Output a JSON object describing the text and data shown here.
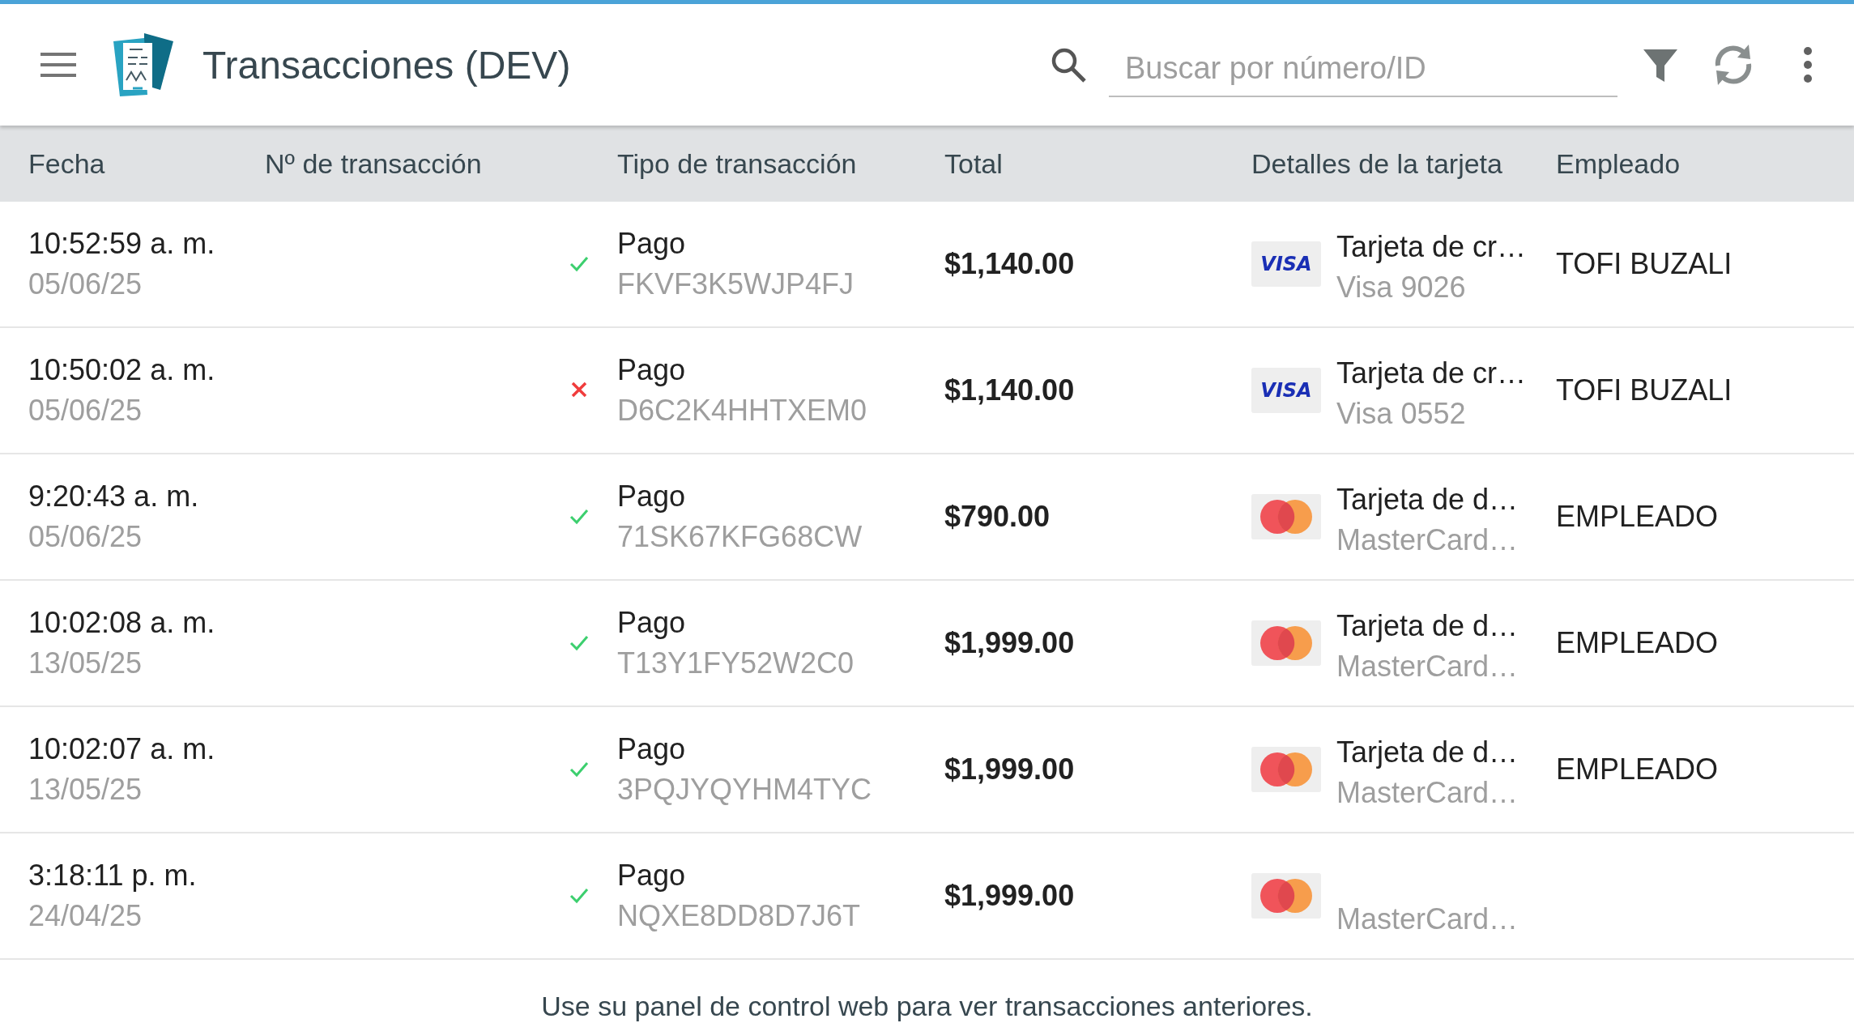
{
  "app_bar": {
    "title": "Transacciones (DEV)",
    "search": {
      "placeholder": "Buscar por número/ID"
    }
  },
  "table": {
    "columns": [
      "Fecha",
      "Nº de transacción",
      "Tipo de transacción",
      "Total",
      "Detalles de la tarjeta",
      "Empleado"
    ],
    "rows": [
      {
        "time": "10:52:59 a. m.",
        "date": "05/06/25",
        "succeeded": true,
        "type": "Pago",
        "id": "FKVF3K5WJP4FJ",
        "total": "$1,140.00",
        "card": {
          "kind": "visa",
          "logo_text": "VISA",
          "title": "Tarjeta de cr…",
          "detail": "Visa 9026"
        },
        "employee": "TOFI BUZALI"
      },
      {
        "time": "10:50:02 a. m.",
        "date": "05/06/25",
        "succeeded": false,
        "type": "Pago",
        "id": "D6C2K4HHTXEM0",
        "total": "$1,140.00",
        "card": {
          "kind": "visa",
          "logo_text": "VISA",
          "title": "Tarjeta de cr…",
          "detail": "Visa 0552"
        },
        "employee": "TOFI BUZALI"
      },
      {
        "time": "9:20:43 a. m.",
        "date": "05/06/25",
        "succeeded": true,
        "type": "Pago",
        "id": "71SK67KFG68CW",
        "total": "$790.00",
        "card": {
          "kind": "mastercard",
          "title": "Tarjeta de d…",
          "detail": "MasterCard…"
        },
        "employee": "EMPLEADO"
      },
      {
        "time": "10:02:08 a. m.",
        "date": "13/05/25",
        "succeeded": true,
        "type": "Pago",
        "id": "T13Y1FY52W2C0",
        "total": "$1,999.00",
        "card": {
          "kind": "mastercard",
          "title": "Tarjeta de d…",
          "detail": "MasterCard…"
        },
        "employee": "EMPLEADO"
      },
      {
        "time": "10:02:07 a. m.",
        "date": "13/05/25",
        "succeeded": true,
        "type": "Pago",
        "id": "3PQJYQYHM4TYC",
        "total": "$1,999.00",
        "card": {
          "kind": "mastercard",
          "title": "Tarjeta de d…",
          "detail": "MasterCard…"
        },
        "employee": "EMPLEADO"
      },
      {
        "time": "3:18:11 p. m.",
        "date": "24/04/25",
        "succeeded": true,
        "type": "Pago",
        "id": "NQXE8DD8D7J6T",
        "total": "$1,999.00",
        "card": {
          "kind": "mastercard",
          "detail": "MasterCard…"
        }
      }
    ]
  },
  "footer": "Use su panel de control web para ver transacciones anteriores."
}
